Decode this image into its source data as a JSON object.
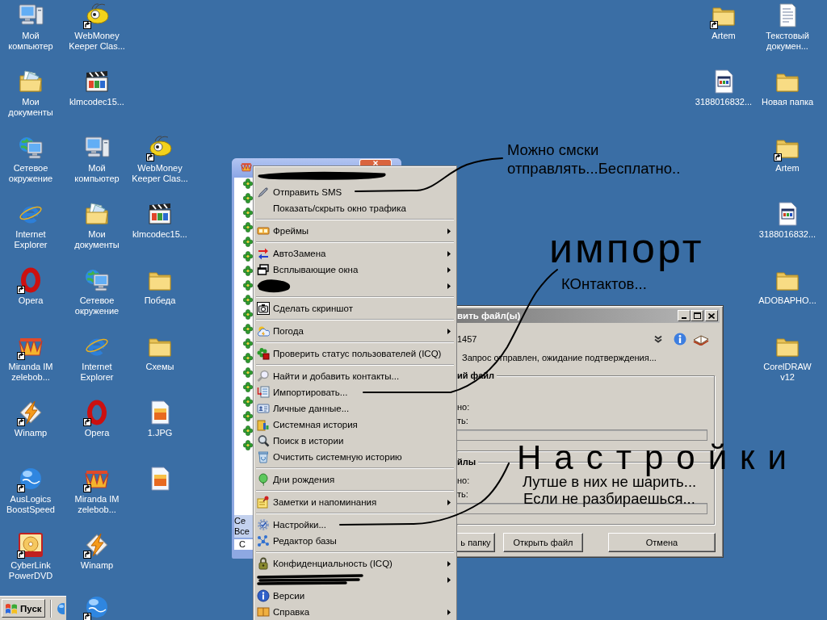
{
  "desktop_icons": [
    {
      "label": "Мой компьютер",
      "shortcut": false
    },
    {
      "label": "WebMoney Keeper Clas...",
      "shortcut": true
    },
    {
      "label": "Artem",
      "shortcut": true
    },
    {
      "label": "Текстовый докумен...",
      "shortcut": false
    },
    {
      "label": "Мои документы",
      "shortcut": false
    },
    {
      "label": "klmcodec15...",
      "shortcut": false
    },
    {
      "label": "3188016832...",
      "shortcut": false
    },
    {
      "label": "Новая папка",
      "shortcut": false
    },
    {
      "label": "Сетевое окружение",
      "shortcut": false
    },
    {
      "label": "Мой компьютер",
      "shortcut": false
    },
    {
      "label": "WebMoney Keeper Clas...",
      "shortcut": true
    },
    {
      "label": "Artem",
      "shortcut": true
    },
    {
      "label": "Internet Explorer",
      "shortcut": false
    },
    {
      "label": "Мои документы",
      "shortcut": false
    },
    {
      "label": "klmcodec15...",
      "shortcut": false
    },
    {
      "label": "3188016832...",
      "shortcut": false
    },
    {
      "label": "Opera",
      "shortcut": true
    },
    {
      "label": "Сетевое окружение",
      "shortcut": false
    },
    {
      "label": "Победа",
      "shortcut": false
    },
    {
      "label": "ADOBAPHO...",
      "shortcut": false
    },
    {
      "label": "Miranda IM zelebob...",
      "shortcut": true
    },
    {
      "label": "Internet Explorer",
      "shortcut": false
    },
    {
      "label": "Схемы",
      "shortcut": false
    },
    {
      "label": "CorelDRAW v12",
      "shortcut": false
    },
    {
      "label": "Winamp",
      "shortcut": true
    },
    {
      "label": "Opera",
      "shortcut": true
    },
    {
      "label": "1.JPG",
      "shortcut": false
    },
    {
      "label": "AusLogics BoostSpeed",
      "shortcut": true
    },
    {
      "label": "Miranda IM zelebob...",
      "shortcut": true
    },
    {
      "shortcut": false
    },
    {
      "label": "CyberLink PowerDVD",
      "shortcut": true
    },
    {
      "label": "Winamp",
      "shortcut": true
    },
    {
      "shortcut": true
    }
  ],
  "taskbar": {
    "start_button": "Пуск"
  },
  "miranda_window": {
    "status_lines": [
      "Се",
      "Все"
    ],
    "status_field": "С"
  },
  "context_menu": {
    "items": [
      {
        "kind": "redacted",
        "submenu": false
      },
      {
        "kind": "item",
        "label": "Отправить SMS",
        "submenu": false
      },
      {
        "kind": "item",
        "label": "Показать/скрыть окно трафика",
        "submenu": false
      },
      {
        "kind": "separator"
      },
      {
        "kind": "item",
        "label": "Фреймы",
        "submenu": true
      },
      {
        "kind": "separator"
      },
      {
        "kind": "item",
        "label": "АвтоЗамена",
        "submenu": true
      },
      {
        "kind": "item",
        "label": "Всплывающие окна",
        "submenu": true
      },
      {
        "kind": "redacted",
        "submenu": true
      },
      {
        "kind": "separator"
      },
      {
        "kind": "item",
        "label": "Сделать скриншот",
        "submenu": false
      },
      {
        "kind": "separator"
      },
      {
        "kind": "item",
        "label": "Погода",
        "submenu": true
      },
      {
        "kind": "separator"
      },
      {
        "kind": "item",
        "label": "Проверить статус пользователей (ICQ)",
        "submenu": false
      },
      {
        "kind": "separator"
      },
      {
        "kind": "item",
        "label": "Найти и добавить контакты...",
        "submenu": false
      },
      {
        "kind": "item",
        "label": "Импортировать...",
        "submenu": false
      },
      {
        "kind": "item",
        "label": "Личные данные...",
        "submenu": false
      },
      {
        "kind": "item",
        "label": "Системная история",
        "submenu": false
      },
      {
        "kind": "item",
        "label": "Поиск в истории",
        "submenu": false
      },
      {
        "kind": "item",
        "label": "Очистить системную историю",
        "submenu": false
      },
      {
        "kind": "separator"
      },
      {
        "kind": "item",
        "label": "Дни рождения",
        "submenu": false
      },
      {
        "kind": "separator"
      },
      {
        "kind": "item",
        "label": "Заметки и напоминания",
        "submenu": true
      },
      {
        "kind": "separator"
      },
      {
        "kind": "item",
        "label": "Настройки...",
        "submenu": false
      },
      {
        "kind": "item",
        "label": "Редактор базы",
        "submenu": false
      },
      {
        "kind": "separator"
      },
      {
        "kind": "item",
        "label": "Конфиденциальность (ICQ)",
        "submenu": true
      },
      {
        "kind": "redacted",
        "submenu": true
      },
      {
        "kind": "item",
        "label": "Версии",
        "submenu": false
      },
      {
        "kind": "item",
        "label": "Справка",
        "submenu": true
      }
    ]
  },
  "transfer_dialog": {
    "title": "вить файл(ы)",
    "uin": "1457",
    "status": "Запрос отправлен, ожидание подтверждения...",
    "groups": [
      {
        "title": "ий файл",
        "rows": [
          "но:",
          "ть:"
        ]
      },
      {
        "title": "йлы",
        "rows": [
          "но:",
          "ть:"
        ]
      }
    ],
    "buttons": [
      "ь папку",
      "Открыть файл",
      "Отмена"
    ]
  },
  "annotations": [
    {
      "kind": "typed",
      "text": "Можно смски отправлять...Бесплатно.."
    },
    {
      "kind": "handwritten",
      "text": "импорт"
    },
    {
      "kind": "typed",
      "text": "КОнтактов..."
    },
    {
      "kind": "handwritten",
      "text": "Настройки"
    },
    {
      "kind": "typed",
      "text": "Лутше в них не шарить..."
    },
    {
      "kind": "typed",
      "text": "Если не разбираешься..."
    }
  ]
}
